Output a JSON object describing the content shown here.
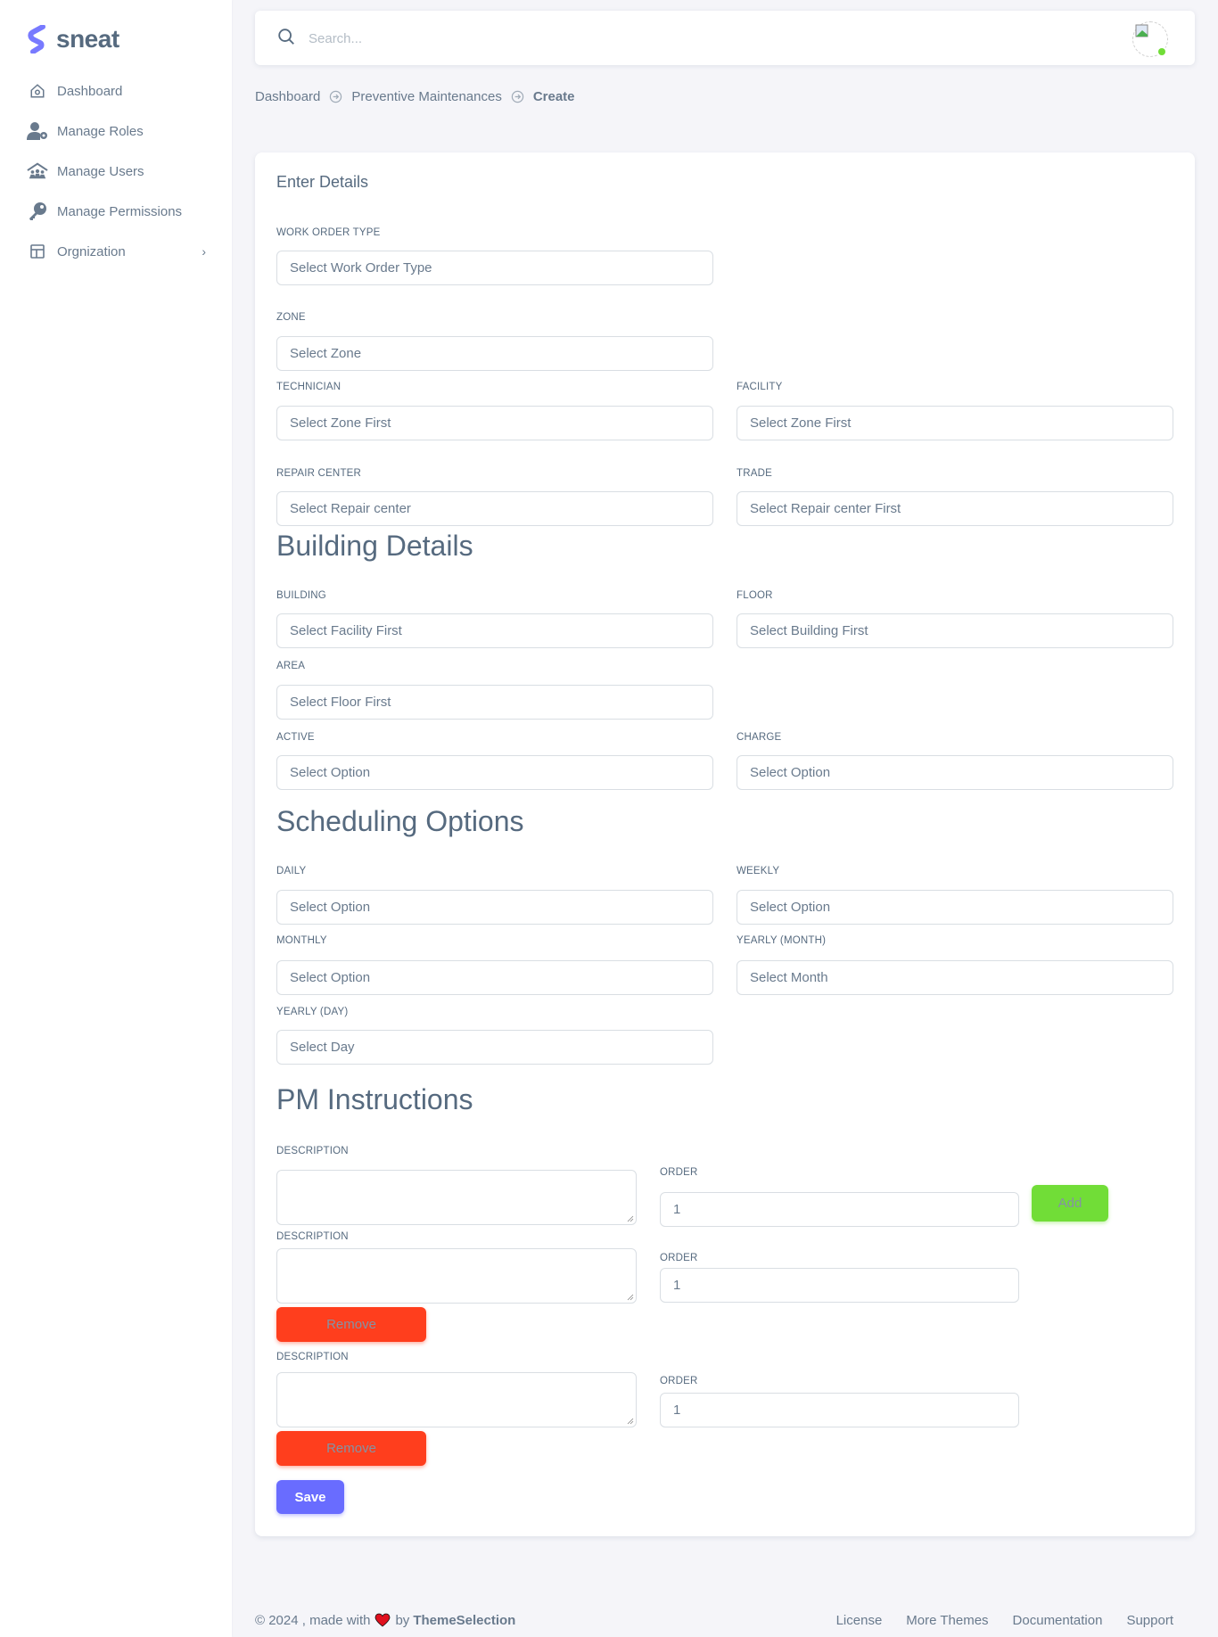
{
  "sidebar": {
    "brand": "sneat",
    "items": [
      {
        "label": "Dashboard",
        "icon": "home-icon"
      },
      {
        "label": "Manage Roles",
        "icon": "user-gear-icon"
      },
      {
        "label": "Manage Users",
        "icon": "users-house-icon"
      },
      {
        "label": "Manage Permissions",
        "icon": "key-icon"
      },
      {
        "label": "Orgnization",
        "icon": "layout-icon",
        "has_submenu": true
      }
    ]
  },
  "navbar": {
    "search_placeholder": "Search...",
    "status_color": "#71dd37"
  },
  "breadcrumb": [
    "Dashboard",
    "Preventive Maintenances",
    "Create"
  ],
  "form": {
    "title": "Enter Details",
    "fields": {
      "work_order_type": {
        "label": "Work Order Type",
        "value": "Select Work Order Type"
      },
      "zone": {
        "label": "Zone",
        "value": "Select Zone"
      },
      "technician": {
        "label": "Technician",
        "value": "Select Zone First"
      },
      "facility": {
        "label": "Facility",
        "value": "Select Zone First"
      },
      "repair_center": {
        "label": "Repair Center",
        "value": "Select Repair center"
      },
      "trade": {
        "label": "Trade",
        "value": "Select Repair center First"
      }
    },
    "building_section": {
      "title": "Building Details",
      "building": {
        "label": "Building",
        "value": "Select Facility First"
      },
      "floor": {
        "label": "Floor",
        "value": "Select Building First"
      },
      "area": {
        "label": "Area",
        "value": "Select Floor First"
      },
      "active": {
        "label": "Active",
        "value": "Select Option"
      },
      "charge": {
        "label": "Charge",
        "value": "Select Option"
      }
    },
    "scheduling_section": {
      "title": "Scheduling Options",
      "daily": {
        "label": "Daily",
        "value": "Select Option"
      },
      "weekly": {
        "label": "Weekly",
        "value": "Select Option"
      },
      "monthly": {
        "label": "Monthly",
        "value": "Select Option"
      },
      "yearly_month": {
        "label": "Yearly (Month)",
        "value": "Select Month"
      },
      "yearly_day": {
        "label": "Yearly (Day)",
        "value": "Select Day"
      }
    },
    "pm_section": {
      "title": "PM Instructions",
      "description_label": "Description",
      "order_label": "Order",
      "rows": [
        {
          "description": "",
          "order": "1"
        },
        {
          "description": "",
          "order": "1"
        },
        {
          "description": "",
          "order": "1"
        }
      ],
      "add_label": "Add",
      "remove_label": "Remove"
    },
    "save_label": "Save"
  },
  "colors": {
    "primary": "#696cff",
    "success": "#71dd37",
    "danger": "#ff3e1d"
  },
  "footer": {
    "copyright": "© 2024 , made with",
    "by": "by",
    "brand": "ThemeSelection",
    "links": [
      "License",
      "More Themes",
      "Documentation",
      "Support"
    ]
  }
}
